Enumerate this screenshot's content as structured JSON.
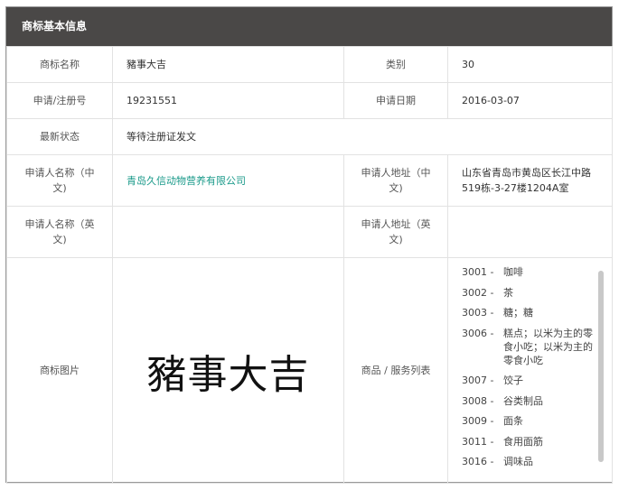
{
  "header": {
    "title": "商标基本信息"
  },
  "rows": {
    "name_label": "商标名称",
    "name_value": "豬事大吉",
    "category_label": "类别",
    "category_value": "30",
    "reg_no_label": "申请/注册号",
    "reg_no_value": "19231551",
    "app_date_label": "申请日期",
    "app_date_value": "2016-03-07",
    "status_label": "最新状态",
    "status_value": "等待注册证发文",
    "applicant_cn_label_1": "申请人名称（中",
    "applicant_cn_label_2": "文)",
    "applicant_cn_value": "青岛久信动物营养有限公司",
    "address_cn_label_1": "申请人地址（中",
    "address_cn_label_2": "文)",
    "address_cn_value_1": "山东省青岛市黄岛区长江中路",
    "address_cn_value_2": "519栋-3-27楼1204A室",
    "applicant_en_label_1": "申请人名称（英",
    "applicant_en_label_2": "文)",
    "address_en_label_1": "申请人地址（英",
    "address_en_label_2": "文)",
    "image_label": "商标图片",
    "image_text": "豬事大吉",
    "goods_label": "商品 / 服务列表"
  },
  "goods": [
    {
      "code": "3001 -",
      "name": "咖啡"
    },
    {
      "code": "3002 -",
      "name": "茶"
    },
    {
      "code": "3003 -",
      "name": "糖；糖"
    },
    {
      "code": "3006 -",
      "name": "糕点；以米为主的零食小吃；以米为主的零食小吃"
    },
    {
      "code": "3007 -",
      "name": "饺子"
    },
    {
      "code": "3008 -",
      "name": "谷类制品"
    },
    {
      "code": "3009 -",
      "name": "面条"
    },
    {
      "code": "3011 -",
      "name": "食用面筋"
    },
    {
      "code": "3016 -",
      "name": "调味品"
    }
  ]
}
